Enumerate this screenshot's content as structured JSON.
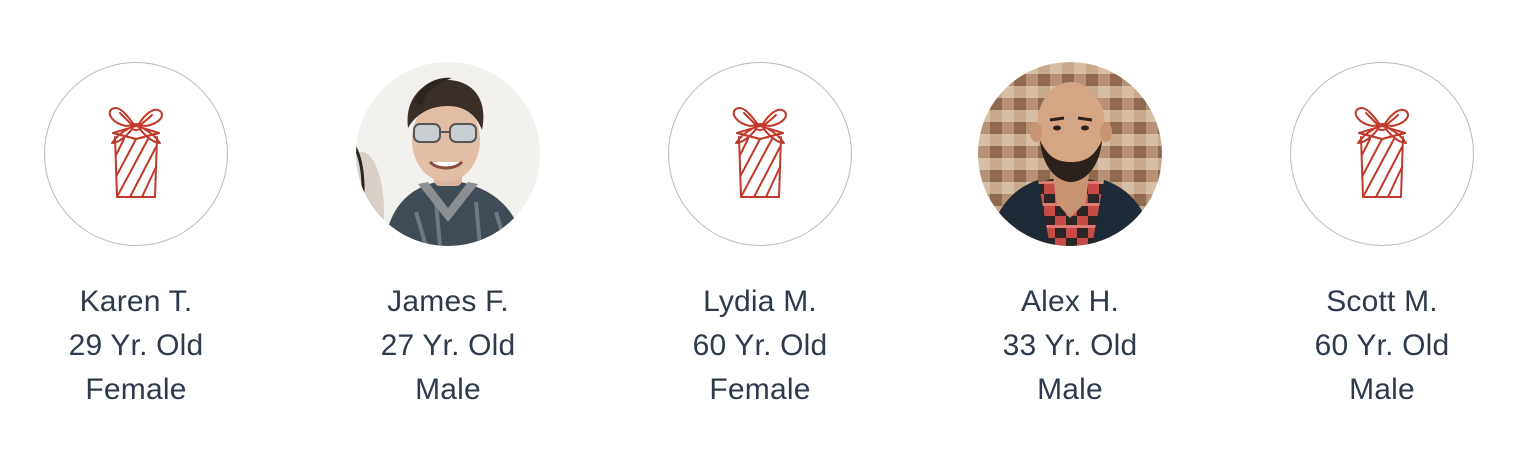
{
  "profiles": [
    {
      "name": "Karen T.",
      "age": "29 Yr. Old",
      "gender": "Female",
      "avatar": "gift-icon"
    },
    {
      "name": "James F.",
      "age": "27 Yr. Old",
      "gender": "Male",
      "avatar": "photo"
    },
    {
      "name": "Lydia M.",
      "age": "60 Yr. Old",
      "gender": "Female",
      "avatar": "gift-icon"
    },
    {
      "name": "Alex H.",
      "age": "33 Yr. Old",
      "gender": "Male",
      "avatar": "photo"
    },
    {
      "name": "Scott M.",
      "age": "60 Yr. Old",
      "gender": "Male",
      "avatar": "gift-icon"
    }
  ],
  "colors": {
    "text": "#2e3a4b",
    "gift_stroke": "#c0392b",
    "placeholder_border": "#b9b9b9"
  }
}
